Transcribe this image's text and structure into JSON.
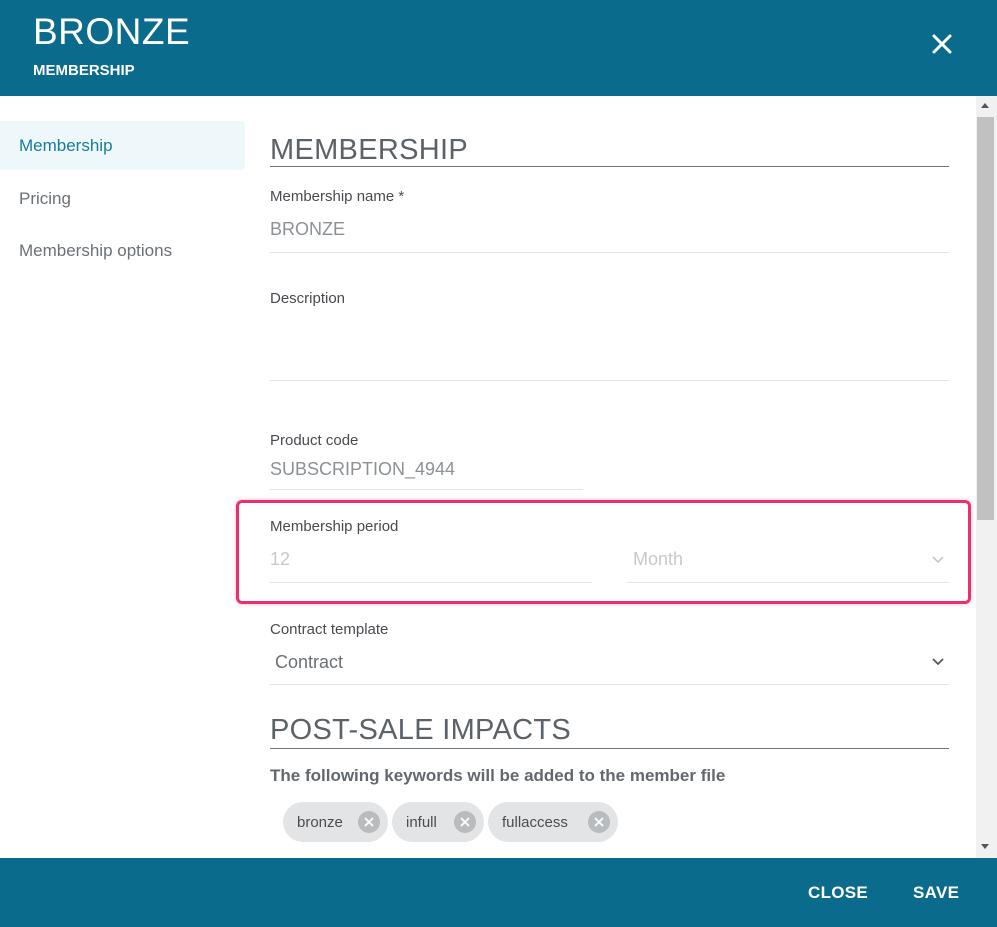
{
  "header": {
    "title": "BRONZE",
    "subtitle": "MEMBERSHIP",
    "close_icon": "close-icon"
  },
  "sidebar": {
    "items": [
      {
        "label": "Membership",
        "active": true
      },
      {
        "label": "Pricing",
        "active": false
      },
      {
        "label": "Membership options",
        "active": false
      }
    ]
  },
  "membership_section": {
    "title": "MEMBERSHIP",
    "name_label": "Membership name *",
    "name_value": "BRONZE",
    "description_label": "Description",
    "description_value": "",
    "product_code_label": "Product code",
    "product_code_value": "SUBSCRIPTION_4944",
    "period_label": "Membership period",
    "period_value": "12",
    "period_unit": "Month",
    "contract_label": "Contract template",
    "contract_value": "Contract"
  },
  "post_sale_section": {
    "title": "POST-SALE IMPACTS",
    "keywords_label": "The following keywords will be added to the member file",
    "keywords": [
      "bronze",
      "infull",
      "fullaccess"
    ]
  },
  "footer": {
    "close_label": "CLOSE",
    "save_label": "SAVE"
  },
  "colors": {
    "header_bg": "#0b6b8c",
    "active_nav_text": "#197c9b",
    "highlight": "#e8326b"
  }
}
